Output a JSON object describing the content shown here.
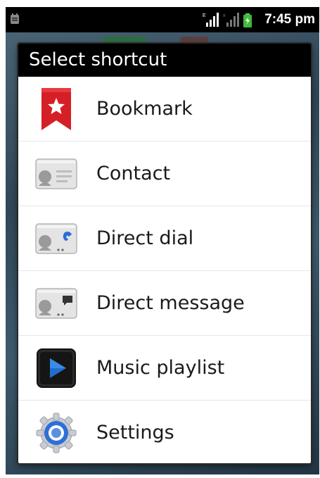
{
  "status_bar": {
    "time": "7:45 pm",
    "icons": [
      "notification-icon",
      "signal-icon",
      "signal-secondary-icon",
      "battery-charging-icon"
    ]
  },
  "dialog": {
    "title": "Select shortcut",
    "items": [
      {
        "label": "Bookmark",
        "icon": "bookmark-icon"
      },
      {
        "label": "Contact",
        "icon": "contact-card-icon"
      },
      {
        "label": "Direct dial",
        "icon": "direct-dial-icon"
      },
      {
        "label": "Direct message",
        "icon": "direct-message-icon"
      },
      {
        "label": "Music playlist",
        "icon": "music-playlist-icon"
      },
      {
        "label": "Settings",
        "icon": "settings-gear-icon"
      }
    ]
  },
  "colors": {
    "title_bar": "#000000",
    "bookmark_red": "#d51f26",
    "playlist_blue": "#1f6fd1",
    "settings_blue": "#2e6fd8"
  }
}
